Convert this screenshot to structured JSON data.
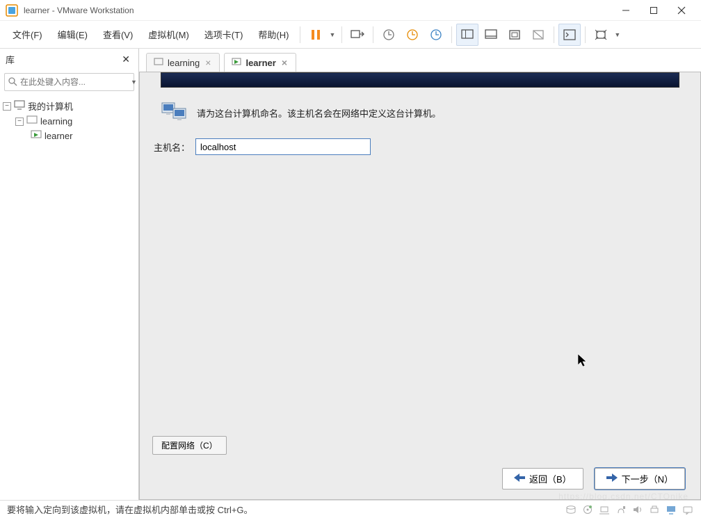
{
  "window": {
    "title": "learner - VMware Workstation"
  },
  "menu": {
    "file": "文件(F)",
    "edit": "编辑(E)",
    "view": "查看(V)",
    "vm": "虚拟机(M)",
    "tabs": "选项卡(T)",
    "help": "帮助(H)"
  },
  "icons": {
    "pause": "pause",
    "printer": "printer",
    "snap1": "snapshot",
    "snap2": "snapshot-orange",
    "snap3": "snapshot-blue",
    "view1": "single-screen",
    "view2": "multi-screen",
    "full": "fullscreen",
    "unity": "unity",
    "console": "console",
    "stretch": "stretch"
  },
  "sidebar": {
    "title": "库",
    "search_placeholder": "在此处键入内容...",
    "tree": {
      "root": "我的计算机",
      "learning": "learning",
      "learner": "learner"
    }
  },
  "tabs": {
    "learning": "learning",
    "learner": "learner"
  },
  "content": {
    "description": "请为这台计算机命名。该主机名会在网络中定义这台计算机。",
    "host_label": "主机名：",
    "host_value": "localhost",
    "config_network": "配置网络（C）",
    "back": "返回（B）",
    "next": "下一步（N）"
  },
  "statusbar": {
    "message": "要将输入定向到该虚拟机，请在虚拟机内部单击或按 Ctrl+G。"
  },
  "watermark": "https://blog.csdn.net/CTOnike"
}
